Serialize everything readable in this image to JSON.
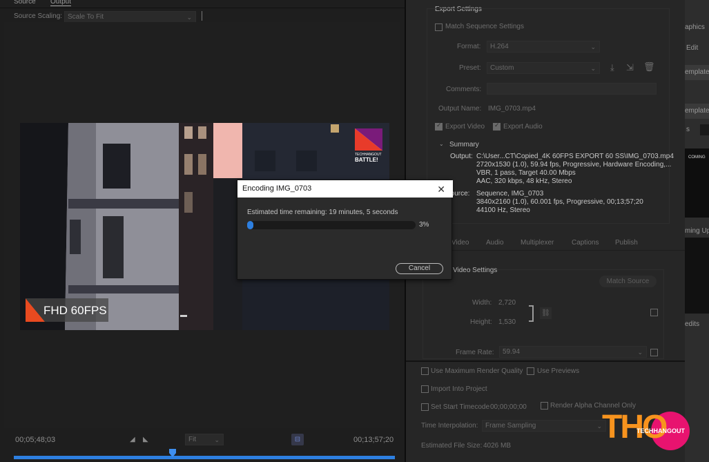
{
  "source_monitor": {
    "tabs": [
      "Source",
      "Output"
    ],
    "source_scaling_label": "Source Scaling:",
    "source_scaling_value": "Scale To Fit",
    "timecode_start": "00;05;48;03",
    "timecode_end": "00;13;57;20",
    "fit_value": "Fit",
    "overlay_text": "FHD 60FPS",
    "corner_logo_lines": [
      "TECHHANGOUT",
      "BATTLE!"
    ]
  },
  "export_settings": {
    "section_title": "Export Settings",
    "match_sequence_label": "Match Sequence Settings",
    "format_label": "Format:",
    "format_value": "H.264",
    "preset_label": "Preset:",
    "preset_value": "Custom",
    "comments_label": "Comments:",
    "output_name_label": "Output Name:",
    "output_name_value": "IMG_0703.mp4",
    "export_video_label": "Export Video",
    "export_audio_label": "Export Audio",
    "summary_title": "Summary",
    "output_label": "Output:",
    "output_lines": [
      "C:\\User...CT\\Copied_4K 60FPS EXPORT 60 SS\\IMG_0703.mp4",
      "2720x1530 (1.0), 59.94 fps, Progressive, Hardware Encoding,...",
      "VBR, 1 pass, Target 40.00 Mbps",
      "AAC, 320 kbps, 48 kHz, Stereo"
    ],
    "source_label": "Source:",
    "source_lines": [
      "Sequence, IMG_0703",
      "3840x2160 (1.0), 60.001 fps, Progressive, 00;13;57;20",
      "44100 Hz, Stereo"
    ],
    "tabs": [
      "Video",
      "Audio",
      "Multiplexer",
      "Captions",
      "Publish"
    ],
    "basic_video_title": "Video Settings",
    "match_source_label": "Match Source",
    "width_label": "Width:",
    "width_value": "2,720",
    "height_label": "Height:",
    "height_value": "1,530",
    "frame_rate_label": "Frame Rate:",
    "frame_rate_value": "59.94",
    "use_max_render_label": "Use Maximum Render Quality",
    "use_previews_label": "Use Previews",
    "import_into_project_label": "Import Into Project",
    "set_start_timecode_label": "Set Start Timecode",
    "start_timecode_value": "00;00;00;00",
    "render_alpha_label": "Render Alpha Channel Only",
    "time_interpolation_label": "Time Interpolation:",
    "time_interpolation_value": "Frame Sampling",
    "estimated_size_label": "Estimated File Size:",
    "estimated_size_value": "4026 MB"
  },
  "encoding_dialog": {
    "title": "Encoding IMG_0703",
    "time_remaining": "Estimated time remaining: 19 minutes, 5 seconds",
    "progress_percent": 3,
    "progress_label": "3%",
    "cancel_label": "Cancel"
  },
  "right_strip": {
    "items": [
      "aphics",
      "Edit",
      "emplate",
      "emplate",
      "s",
      "COMING",
      "ming Up",
      "edits"
    ]
  },
  "watermark": {
    "big_text": "THO",
    "small_text": "TECHHANGOUT"
  },
  "colors": {
    "progress_fill": "#2d7fe0",
    "watermark_orange": "#f7931e",
    "watermark_pink": "#e8136f"
  }
}
